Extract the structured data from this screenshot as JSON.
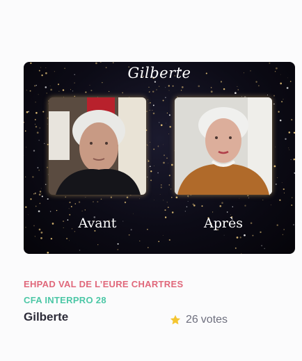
{
  "entry": {
    "image": {
      "title": "Gilberte",
      "before_label": "Avant",
      "after_label": "Après"
    },
    "establishment": "EHPAD VAL DE L’EURE CHARTRES",
    "school": "CFA INTERPRO 28",
    "name": "Gilberte",
    "votes": {
      "count": "26",
      "label": "votes",
      "icon": "star-icon"
    }
  },
  "colors": {
    "establishment": "#e0677a",
    "school": "#4cc7a6",
    "name": "#2c2b38",
    "votes": "#6e6f7e",
    "star": "#f4c531",
    "image_background": "#0c0b16"
  }
}
